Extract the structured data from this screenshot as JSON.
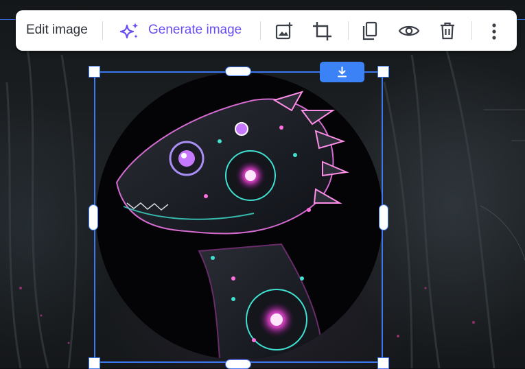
{
  "toolbar": {
    "edit_label": "Edit image",
    "generate_label": "Generate image",
    "icons": [
      "sparkle-icon",
      "image-add-icon",
      "crop-icon",
      "duplicate-icon",
      "eye-icon",
      "trash-icon",
      "more-vertical-icon"
    ]
  },
  "canvas": {
    "selected_image": "cyberpunk robotic dinosaur portrait",
    "download_icon": "download-icon"
  },
  "colors": {
    "accent": "#3b78f2",
    "generate": "#6a4df0",
    "download_button": "#3b82f6"
  }
}
